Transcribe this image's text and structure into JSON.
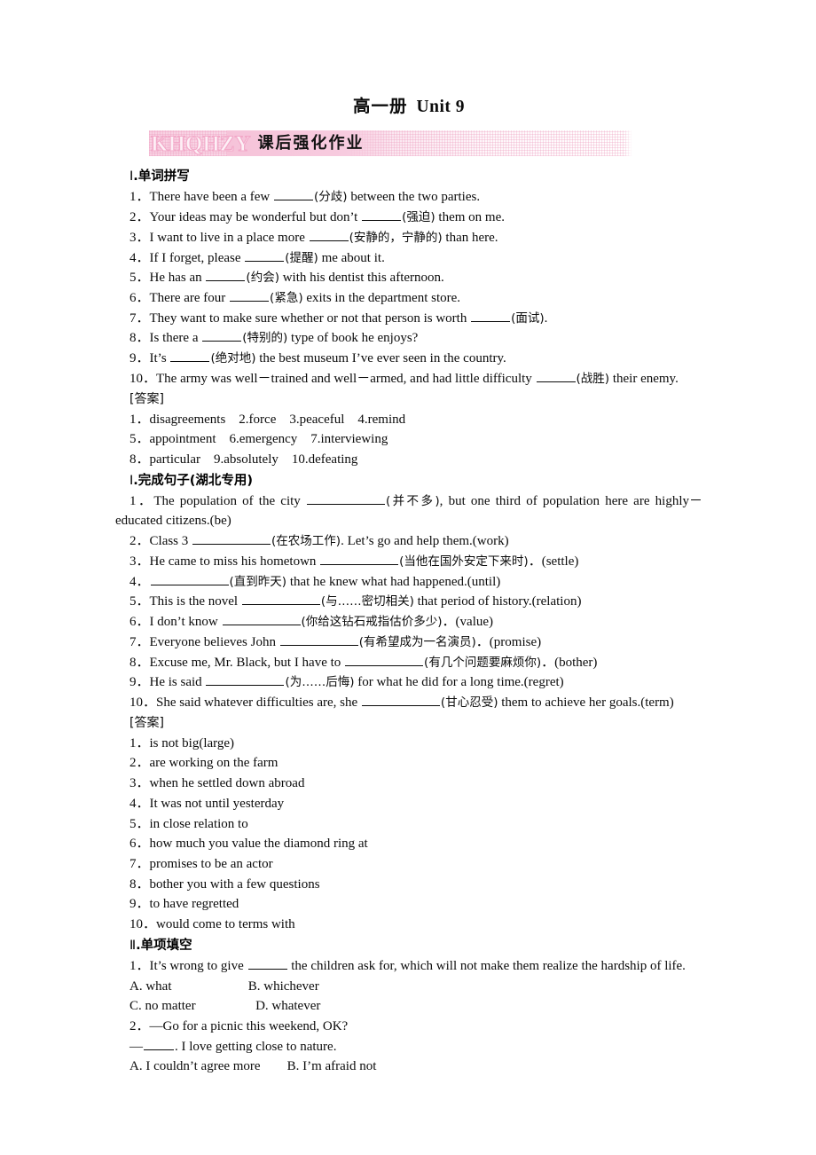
{
  "title": {
    "cn": "高一册",
    "en": "Unit 9"
  },
  "banner": {
    "logo": "KHQHZY",
    "label": "课后强化作业",
    "accent": "#f2a8c8"
  },
  "sections": [
    {
      "heading_numeral": "Ⅰ",
      "heading_text": ".单词拼写",
      "questions": [
        {
          "n": "1．",
          "pre": "There have been a few ",
          "hint": "(分歧)",
          "post": " between the two parties.",
          "blank": "b-s"
        },
        {
          "n": "2．",
          "pre": "Your ideas may be wonderful but don’t ",
          "hint": "(强迫)",
          "post": " them on me.",
          "blank": "b-s"
        },
        {
          "n": "3．",
          "pre": "I want to live in a place more ",
          "hint": "(安静的，宁静的)",
          "post": " than here.",
          "blank": "b-s"
        },
        {
          "n": "4．",
          "pre": "If I forget, please ",
          "hint": "(提醒)",
          "post": " me about it.",
          "blank": "b-s"
        },
        {
          "n": "5．",
          "pre": "He has an ",
          "hint": "(约会)",
          "post": " with his dentist this afternoon.",
          "blank": "b-s"
        },
        {
          "n": "6．",
          "pre": "There are four ",
          "hint": "(紧急)",
          "post": " exits in the department store.",
          "blank": "b-s"
        },
        {
          "n": "7．",
          "pre": "They want to make sure whether or not that person is worth ",
          "hint": "(面试)",
          "post": ".",
          "blank": "b-s"
        },
        {
          "n": "8．",
          "pre": "Is there a ",
          "hint": "(特别的)",
          "post": " type of book he enjoys?",
          "blank": "b-s"
        },
        {
          "n": "9．",
          "pre": "It’s ",
          "hint": "(绝对地)",
          "post": " the best museum I’ve ever seen in the country.",
          "blank": "b-s"
        },
        {
          "n": "10．",
          "pre": "The army was well－trained and well－armed, and had little difficulty ",
          "hint": "(战胜)",
          "post": " their enemy.",
          "blank": "b-s"
        }
      ],
      "answer_label": "[答案]",
      "answers": [
        "1．disagreements　2.force　3.peaceful　4.remind",
        "5．appointment　6.emergency　7.interviewing",
        "8．particular　9.absolutely　10.defeating"
      ]
    },
    {
      "heading_numeral": "Ⅰ",
      "heading_text": ".完成句子(湖北专用)",
      "questions": [
        {
          "n": "1．",
          "pre": "The population of the city ",
          "hint": "(并不多)",
          "post": ", but one third of population here are highly－educated citizens.(be)",
          "blank": "b-m"
        },
        {
          "n": "2．",
          "pre": "Class 3 ",
          "hint": "(在农场工作)",
          "post": ". Let’s go and help them.(work)",
          "blank": "b-m"
        },
        {
          "n": "3．",
          "pre": "He came to miss his hometown ",
          "hint": "(当他在国外安定下来时)",
          "post": "．(settle)",
          "blank": "b-m"
        },
        {
          "n": "4．",
          "pre": "",
          "hint": "(直到昨天)",
          "post": " that he knew what had happened.(until)",
          "blank": "b-m"
        },
        {
          "n": "5．",
          "pre": "This is the novel ",
          "hint": "(与……密切相关)",
          "post": " that period of history.(relation)",
          "blank": "b-m"
        },
        {
          "n": "6．",
          "pre": "I don’t know ",
          "hint": "(你给这钻石戒指估价多少)",
          "post": "．(value)",
          "blank": "b-m"
        },
        {
          "n": "7．",
          "pre": "Everyone believes John ",
          "hint": "(有希望成为一名演员)",
          "post": "．(promise)",
          "blank": "b-m"
        },
        {
          "n": "8．",
          "pre": "Excuse me, Mr. Black, but I have to ",
          "hint": "(有几个问题要麻烦你)",
          "post": "．(bother)",
          "blank": "b-m"
        },
        {
          "n": "9．",
          "pre": "He is said ",
          "hint": "(为……后悔)",
          "post": " for what he did for a long time.(regret)",
          "blank": "b-m"
        },
        {
          "n": "10．",
          "pre": "She said whatever difficulties are, she ",
          "hint": "(甘心忍受)",
          "post": " them to achieve her goals.(term)",
          "blank": "b-m"
        }
      ],
      "answer_label": "[答案]",
      "answers": [
        "1．is not big(large)",
        "2．are working on the farm",
        "3．when he settled down abroad",
        "4．It was not until yesterday",
        "5．in close relation to",
        "6．how much you value the diamond ring at",
        "7．promises to be an actor",
        "8．bother you with a few questions",
        "9．to have regretted",
        "10．would come to terms with"
      ]
    }
  ],
  "section3": {
    "heading_numeral": "Ⅱ",
    "heading_text": ".单项填空",
    "items": [
      {
        "n": "1．",
        "stem_pre": "It’s wrong to give ",
        "stem_post": " the children ask for, which will not make them realize the hardship of life.",
        "options": [
          "A. what                       B. whichever",
          "C. no matter                  D. whatever"
        ]
      },
      {
        "n": "2．",
        "line1": "—Go for a picnic this weekend, OK?",
        "line2_pre": "—",
        "line2_post": ". I love getting close to nature.",
        "options": [
          "A. I couldn’t agree more　　B. I’m afraid not"
        ]
      }
    ]
  }
}
